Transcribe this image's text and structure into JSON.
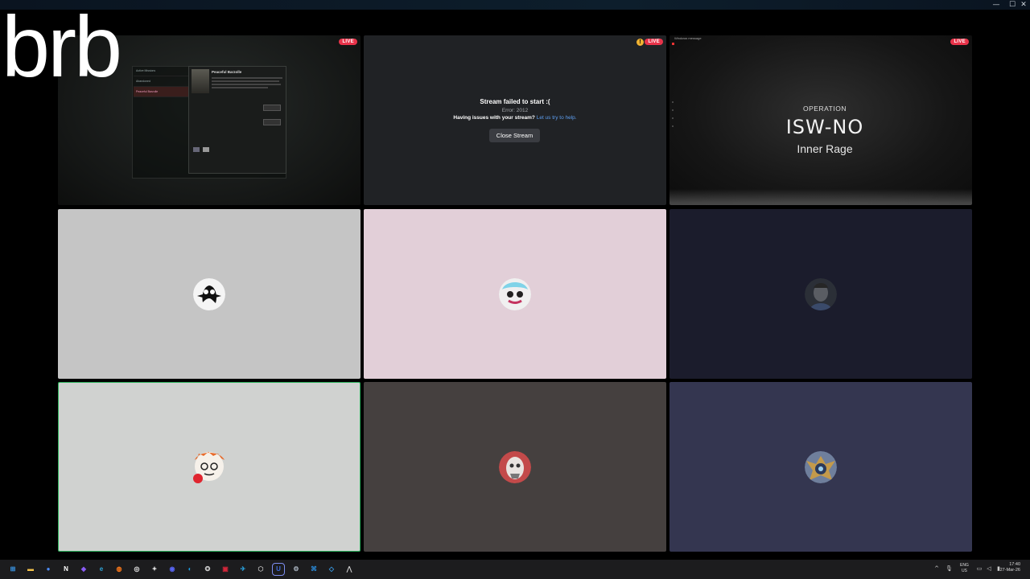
{
  "window": {
    "controls": [
      "—",
      "☐",
      "✕"
    ]
  },
  "overlay": {
    "brb_text": "brb"
  },
  "tiles": {
    "game": {
      "live_label": "LIVE",
      "sidebar_items": [
        "Active Missions",
        "Abandoned",
        "Peaceful Barzolle"
      ],
      "card_name": "Peaceful Barzolle"
    },
    "stream_error": {
      "live_label": "LIVE",
      "warning_glyph": "!",
      "title": "Stream failed to start :(",
      "error": "Error: 2012",
      "help_text": "Having issues with your stream?",
      "help_link": "Let us try to help.",
      "close_button": "Close Stream"
    },
    "operation": {
      "live_label": "LIVE",
      "tab_label": "Windows message",
      "heading": "OPERATION",
      "code": "ISW-NO",
      "subtitle": "Inner Rage"
    }
  },
  "participants": [
    {
      "name": "participant-1",
      "bg": "#c5c5c5",
      "avatar_color": "#111111"
    },
    {
      "name": "participant-2",
      "bg": "#e2cfd8",
      "avatar_color": "#7fd3e8"
    },
    {
      "name": "participant-3",
      "bg": "#1b1c2c",
      "avatar_color": "#4a4f57"
    },
    {
      "name": "participant-4",
      "bg": "#d0d2d0",
      "avatar_color": "#e86a2a",
      "speaking": true
    },
    {
      "name": "participant-5",
      "bg": "#45403f",
      "avatar_color": "#c34a4a"
    },
    {
      "name": "participant-6",
      "bg": "#343650",
      "avatar_color": "#c49a4a"
    }
  ],
  "taskbar": {
    "apps": [
      {
        "name": "windows-start",
        "glyph": "⊞",
        "color": "#3b9cf0"
      },
      {
        "name": "file-explorer",
        "glyph": "▬",
        "color": "#f3c34b"
      },
      {
        "name": "chrome",
        "glyph": "●",
        "color": "#4c8bf5"
      },
      {
        "name": "notion",
        "glyph": "N",
        "color": "#ffffff"
      },
      {
        "name": "obsidian",
        "glyph": "◆",
        "color": "#8a5cf5"
      },
      {
        "name": "edge",
        "glyph": "e",
        "color": "#2ea4d8"
      },
      {
        "name": "firefox",
        "glyph": "◍",
        "color": "#ff7a1a"
      },
      {
        "name": "steam-chat",
        "glyph": "◎",
        "color": "#e9e9e9"
      },
      {
        "name": "game-launcher",
        "glyph": "✦",
        "color": "#dddddd"
      },
      {
        "name": "discord",
        "glyph": "◉",
        "color": "#5865f2"
      },
      {
        "name": "steam",
        "glyph": "◐",
        "color": "#1b9de2"
      },
      {
        "name": "app-rocket",
        "glyph": "✪",
        "color": "#c7c7c7"
      },
      {
        "name": "app-red",
        "glyph": "▣",
        "color": "#d3263a"
      },
      {
        "name": "app-telegram",
        "glyph": "✈",
        "color": "#2aa3e0"
      },
      {
        "name": "app-settings-hex",
        "glyph": "⬡",
        "color": "#bbbbbb"
      },
      {
        "name": "bitwarden",
        "glyph": "U",
        "color": "#3f6ce0"
      },
      {
        "name": "settings",
        "glyph": "⚙",
        "color": "#aab4c0"
      },
      {
        "name": "vscode",
        "glyph": "⌘",
        "color": "#2a8ad8"
      },
      {
        "name": "app-blue-active",
        "glyph": "◇",
        "color": "#3aa0ee"
      },
      {
        "name": "app-arrow",
        "glyph": "⋀",
        "color": "#cfcfcf"
      }
    ],
    "tray": {
      "lang_line1": "ENG",
      "lang_line2": "US",
      "time": "17:40",
      "date": "27-Mar-26"
    }
  }
}
